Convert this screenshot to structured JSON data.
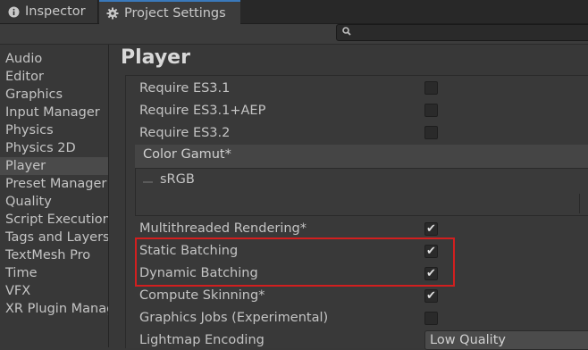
{
  "tabs": [
    {
      "label": "Inspector",
      "icon": "info-icon"
    },
    {
      "label": "Project Settings",
      "icon": "gear-icon"
    }
  ],
  "search": {
    "placeholder": ""
  },
  "sidebar": {
    "items": [
      {
        "label": "Audio"
      },
      {
        "label": "Editor"
      },
      {
        "label": "Graphics"
      },
      {
        "label": "Input Manager"
      },
      {
        "label": "Physics"
      },
      {
        "label": "Physics 2D"
      },
      {
        "label": "Player",
        "selected": true
      },
      {
        "label": "Preset Manager"
      },
      {
        "label": "Quality"
      },
      {
        "label": "Script Execution Order"
      },
      {
        "label": "Tags and Layers"
      },
      {
        "label": "TextMesh Pro"
      },
      {
        "label": "Time"
      },
      {
        "label": "VFX"
      },
      {
        "label": "XR Plugin Management"
      }
    ]
  },
  "main": {
    "title": "Player",
    "settings_top": [
      {
        "label": "Require ES3.1",
        "checked": false
      },
      {
        "label": "Require ES3.1+AEP",
        "checked": false
      },
      {
        "label": "Require ES3.2",
        "checked": false
      }
    ],
    "color_gamut": {
      "title": "Color Gamut*",
      "items": [
        "sRGB"
      ]
    },
    "settings_bottom": [
      {
        "label": "Multithreaded Rendering*",
        "checked": true
      },
      {
        "label": "Static Batching",
        "checked": true
      },
      {
        "label": "Dynamic Batching",
        "checked": true
      },
      {
        "label": "Compute Skinning*",
        "checked": true
      },
      {
        "label": "Graphics Jobs (Experimental)",
        "checked": false
      }
    ],
    "lightmap_encoding": {
      "label": "Lightmap Encoding",
      "value": "Low Quality"
    }
  },
  "colors": {
    "highlight_box": "#d21f1f",
    "active_tab_accent": "#3a79bb"
  }
}
